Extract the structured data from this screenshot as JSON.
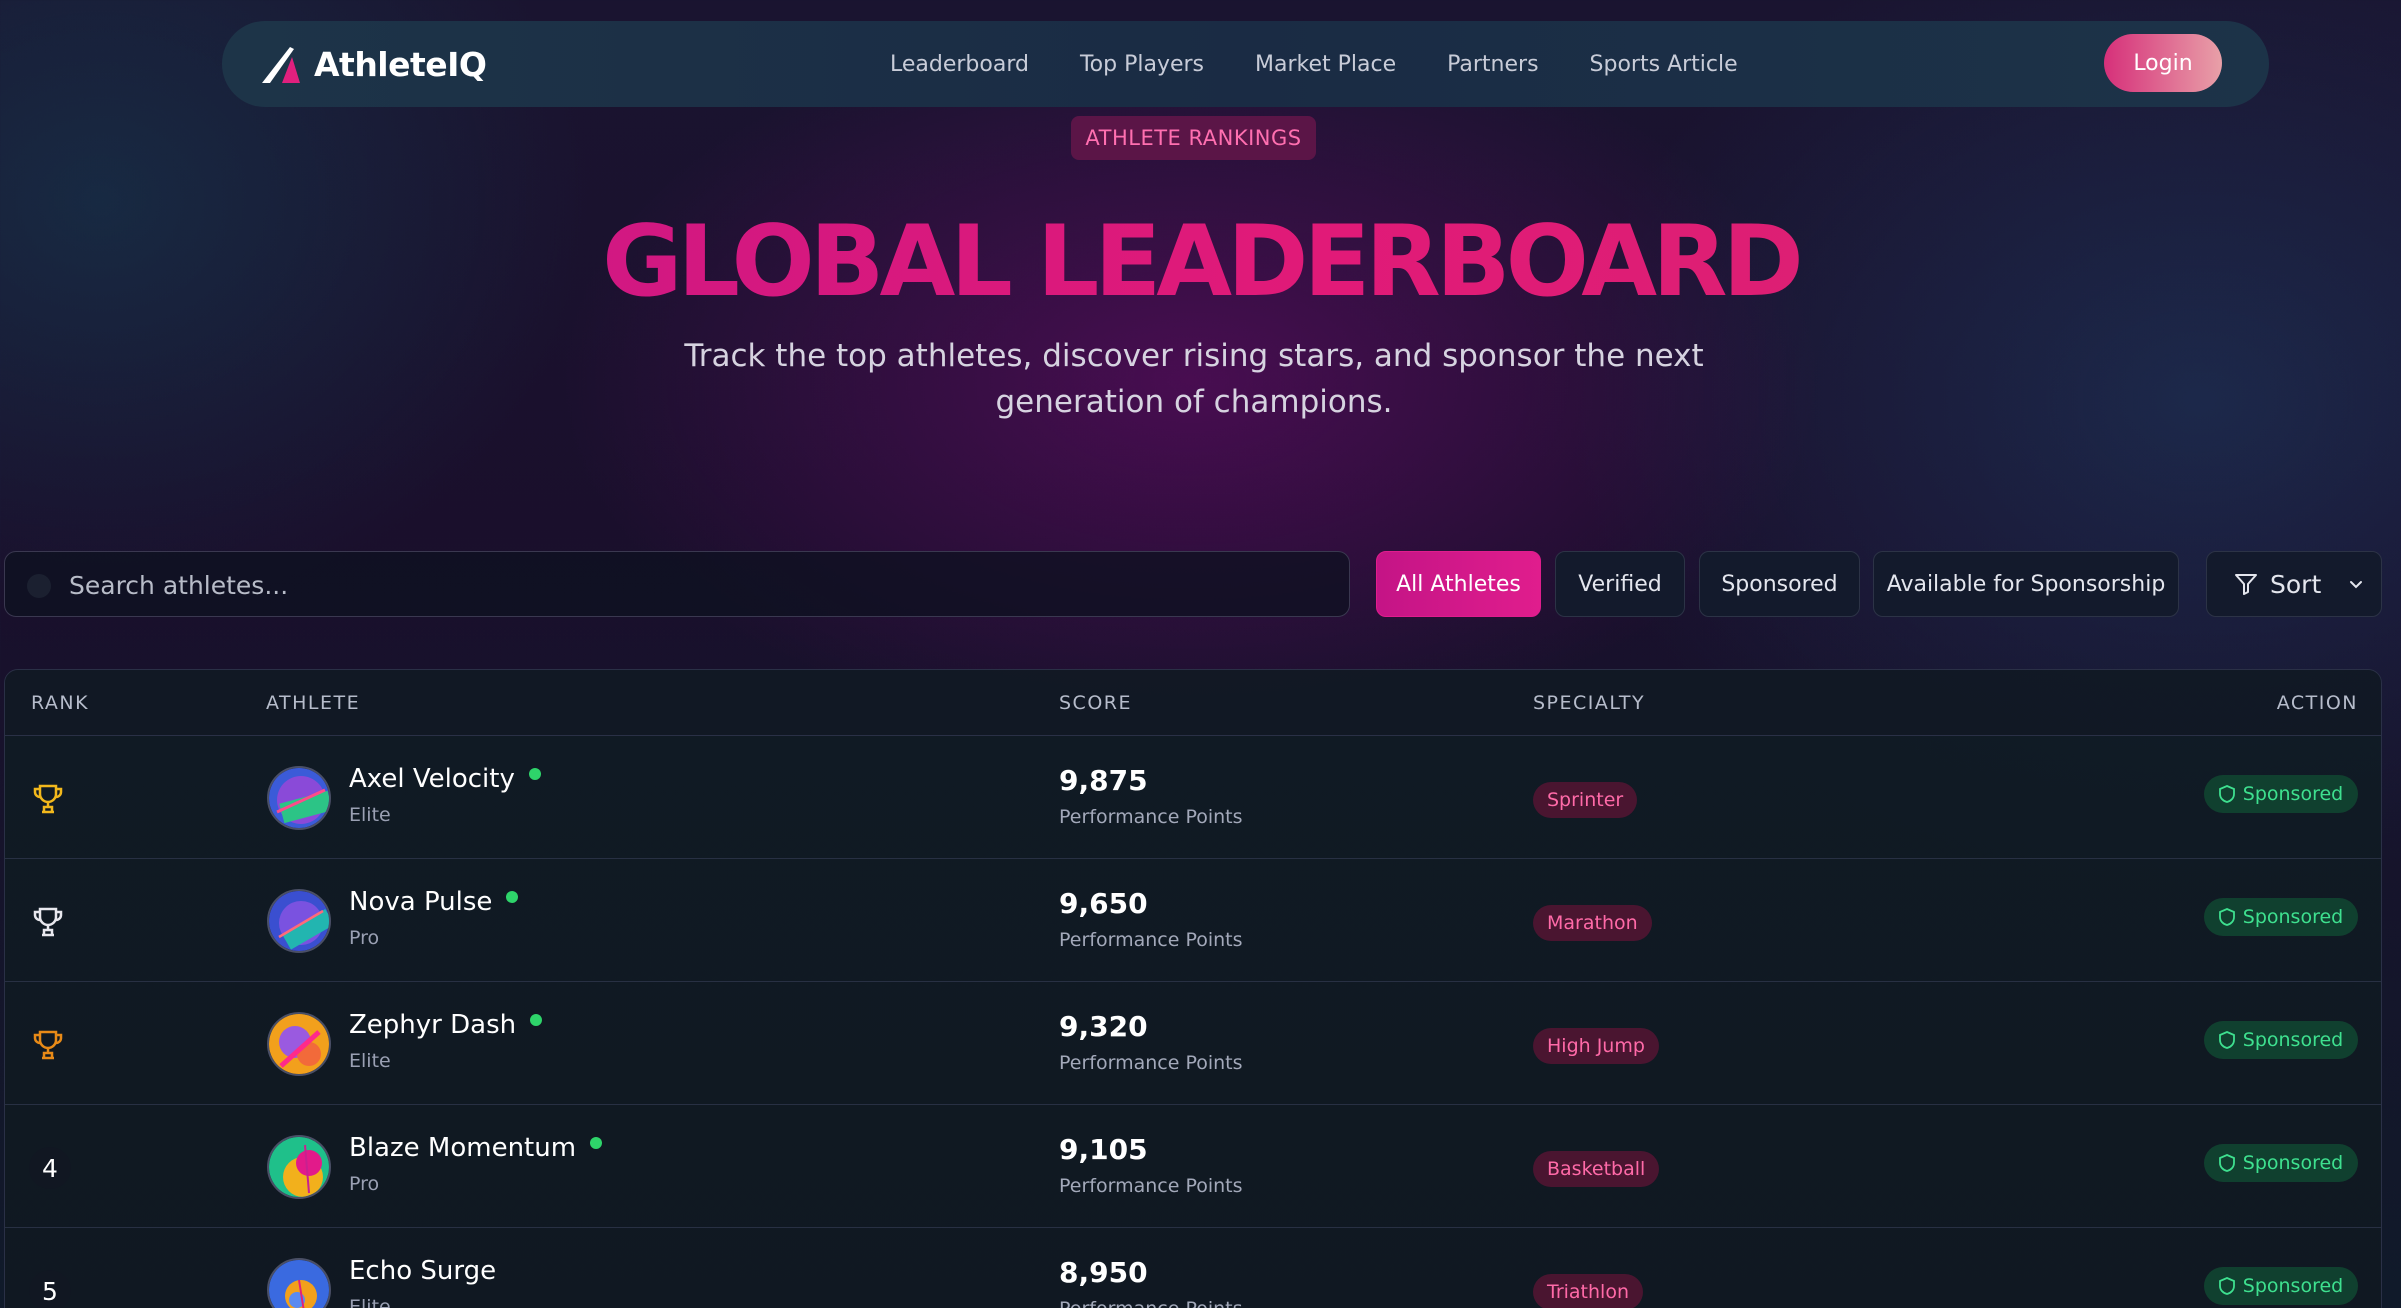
{
  "header": {
    "brand": "AthleteIQ",
    "nav": [
      "Leaderboard",
      "Top Players",
      "Market Place",
      "Partners",
      "Sports Article"
    ],
    "login_label": "Login"
  },
  "hero": {
    "badge": "ATHLETE RANKINGS",
    "title": "GLOBAL LEADERBOARD",
    "subtitle": "Track the top athletes, discover rising stars, and sponsor the next generation of champions."
  },
  "toolbar": {
    "search_placeholder": "Search athletes...",
    "filters": [
      "All Athletes",
      "Verified",
      "Sponsored",
      "Available for Sponsorship"
    ],
    "active_filter": "All Athletes",
    "sort_label": "Sort"
  },
  "table": {
    "columns": [
      "RANK",
      "ATHLETE",
      "SCORE",
      "SPECIALTY",
      "ACTION"
    ],
    "rows": [
      {
        "rank": "1",
        "rank_icon": "trophy-gold-icon",
        "name": "Axel Velocity",
        "online": true,
        "tier": "Elite",
        "score": "9,875",
        "unit": "Performance Points",
        "specialty": "Sprinter",
        "action": "Sponsored"
      },
      {
        "rank": "2",
        "rank_icon": "trophy-silver-icon",
        "name": "Nova Pulse",
        "online": true,
        "tier": "Pro",
        "score": "9,650",
        "unit": "Performance Points",
        "specialty": "Marathon",
        "action": "Sponsored"
      },
      {
        "rank": "3",
        "rank_icon": "trophy-bronze-icon",
        "name": "Zephyr Dash",
        "online": true,
        "tier": "Elite",
        "score": "9,320",
        "unit": "Performance Points",
        "specialty": "High Jump",
        "action": "Sponsored"
      },
      {
        "rank": "4",
        "rank_icon": "",
        "name": "Blaze Momentum",
        "online": true,
        "tier": "Pro",
        "score": "9,105",
        "unit": "Performance Points",
        "specialty": "Basketball",
        "action": "Sponsored"
      },
      {
        "rank": "5",
        "rank_icon": "",
        "name": "Echo Surge",
        "online": false,
        "tier": "Elite",
        "score": "8,950",
        "unit": "Performance Points",
        "specialty": "Triathlon",
        "action": "Sponsored"
      }
    ]
  },
  "colors": {
    "accent": "#e01d8d",
    "success": "#3ee08f",
    "gold": "#f2b81c",
    "silver": "#e8e8ee",
    "bronze": "#e88a17"
  }
}
